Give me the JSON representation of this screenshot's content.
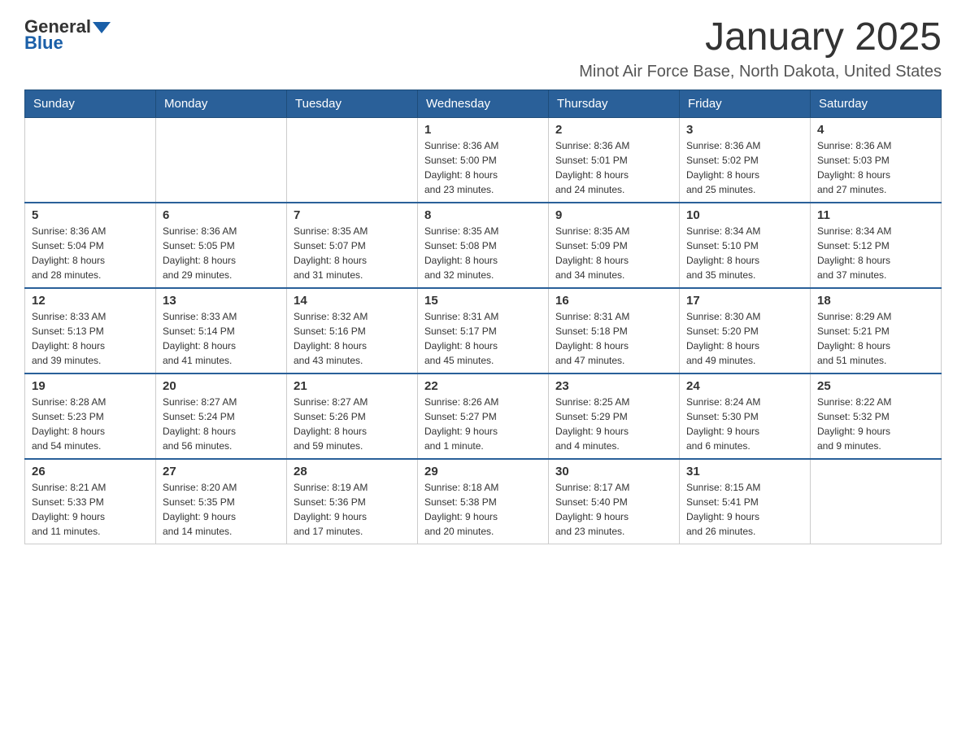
{
  "logo": {
    "general": "General",
    "blue": "Blue"
  },
  "header": {
    "title": "January 2025",
    "subtitle": "Minot Air Force Base, North Dakota, United States"
  },
  "weekdays": [
    "Sunday",
    "Monday",
    "Tuesday",
    "Wednesday",
    "Thursday",
    "Friday",
    "Saturday"
  ],
  "weeks": [
    [
      {
        "day": "",
        "info": ""
      },
      {
        "day": "",
        "info": ""
      },
      {
        "day": "",
        "info": ""
      },
      {
        "day": "1",
        "info": "Sunrise: 8:36 AM\nSunset: 5:00 PM\nDaylight: 8 hours\nand 23 minutes."
      },
      {
        "day": "2",
        "info": "Sunrise: 8:36 AM\nSunset: 5:01 PM\nDaylight: 8 hours\nand 24 minutes."
      },
      {
        "day": "3",
        "info": "Sunrise: 8:36 AM\nSunset: 5:02 PM\nDaylight: 8 hours\nand 25 minutes."
      },
      {
        "day": "4",
        "info": "Sunrise: 8:36 AM\nSunset: 5:03 PM\nDaylight: 8 hours\nand 27 minutes."
      }
    ],
    [
      {
        "day": "5",
        "info": "Sunrise: 8:36 AM\nSunset: 5:04 PM\nDaylight: 8 hours\nand 28 minutes."
      },
      {
        "day": "6",
        "info": "Sunrise: 8:36 AM\nSunset: 5:05 PM\nDaylight: 8 hours\nand 29 minutes."
      },
      {
        "day": "7",
        "info": "Sunrise: 8:35 AM\nSunset: 5:07 PM\nDaylight: 8 hours\nand 31 minutes."
      },
      {
        "day": "8",
        "info": "Sunrise: 8:35 AM\nSunset: 5:08 PM\nDaylight: 8 hours\nand 32 minutes."
      },
      {
        "day": "9",
        "info": "Sunrise: 8:35 AM\nSunset: 5:09 PM\nDaylight: 8 hours\nand 34 minutes."
      },
      {
        "day": "10",
        "info": "Sunrise: 8:34 AM\nSunset: 5:10 PM\nDaylight: 8 hours\nand 35 minutes."
      },
      {
        "day": "11",
        "info": "Sunrise: 8:34 AM\nSunset: 5:12 PM\nDaylight: 8 hours\nand 37 minutes."
      }
    ],
    [
      {
        "day": "12",
        "info": "Sunrise: 8:33 AM\nSunset: 5:13 PM\nDaylight: 8 hours\nand 39 minutes."
      },
      {
        "day": "13",
        "info": "Sunrise: 8:33 AM\nSunset: 5:14 PM\nDaylight: 8 hours\nand 41 minutes."
      },
      {
        "day": "14",
        "info": "Sunrise: 8:32 AM\nSunset: 5:16 PM\nDaylight: 8 hours\nand 43 minutes."
      },
      {
        "day": "15",
        "info": "Sunrise: 8:31 AM\nSunset: 5:17 PM\nDaylight: 8 hours\nand 45 minutes."
      },
      {
        "day": "16",
        "info": "Sunrise: 8:31 AM\nSunset: 5:18 PM\nDaylight: 8 hours\nand 47 minutes."
      },
      {
        "day": "17",
        "info": "Sunrise: 8:30 AM\nSunset: 5:20 PM\nDaylight: 8 hours\nand 49 minutes."
      },
      {
        "day": "18",
        "info": "Sunrise: 8:29 AM\nSunset: 5:21 PM\nDaylight: 8 hours\nand 51 minutes."
      }
    ],
    [
      {
        "day": "19",
        "info": "Sunrise: 8:28 AM\nSunset: 5:23 PM\nDaylight: 8 hours\nand 54 minutes."
      },
      {
        "day": "20",
        "info": "Sunrise: 8:27 AM\nSunset: 5:24 PM\nDaylight: 8 hours\nand 56 minutes."
      },
      {
        "day": "21",
        "info": "Sunrise: 8:27 AM\nSunset: 5:26 PM\nDaylight: 8 hours\nand 59 minutes."
      },
      {
        "day": "22",
        "info": "Sunrise: 8:26 AM\nSunset: 5:27 PM\nDaylight: 9 hours\nand 1 minute."
      },
      {
        "day": "23",
        "info": "Sunrise: 8:25 AM\nSunset: 5:29 PM\nDaylight: 9 hours\nand 4 minutes."
      },
      {
        "day": "24",
        "info": "Sunrise: 8:24 AM\nSunset: 5:30 PM\nDaylight: 9 hours\nand 6 minutes."
      },
      {
        "day": "25",
        "info": "Sunrise: 8:22 AM\nSunset: 5:32 PM\nDaylight: 9 hours\nand 9 minutes."
      }
    ],
    [
      {
        "day": "26",
        "info": "Sunrise: 8:21 AM\nSunset: 5:33 PM\nDaylight: 9 hours\nand 11 minutes."
      },
      {
        "day": "27",
        "info": "Sunrise: 8:20 AM\nSunset: 5:35 PM\nDaylight: 9 hours\nand 14 minutes."
      },
      {
        "day": "28",
        "info": "Sunrise: 8:19 AM\nSunset: 5:36 PM\nDaylight: 9 hours\nand 17 minutes."
      },
      {
        "day": "29",
        "info": "Sunrise: 8:18 AM\nSunset: 5:38 PM\nDaylight: 9 hours\nand 20 minutes."
      },
      {
        "day": "30",
        "info": "Sunrise: 8:17 AM\nSunset: 5:40 PM\nDaylight: 9 hours\nand 23 minutes."
      },
      {
        "day": "31",
        "info": "Sunrise: 8:15 AM\nSunset: 5:41 PM\nDaylight: 9 hours\nand 26 minutes."
      },
      {
        "day": "",
        "info": ""
      }
    ]
  ]
}
